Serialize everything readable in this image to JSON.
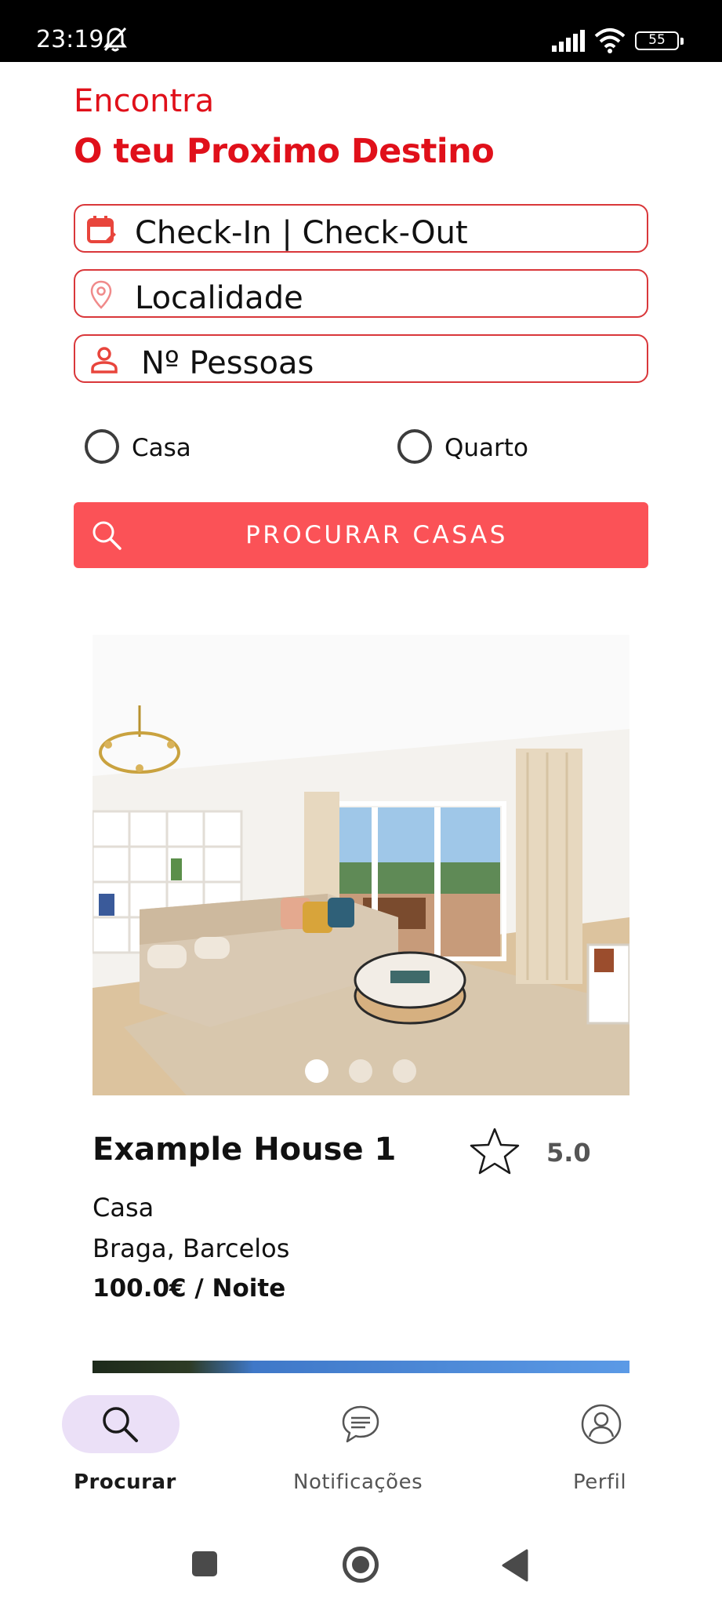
{
  "status_bar": {
    "time": "23:19",
    "battery": "55",
    "icons": [
      "bell-off-icon",
      "signal-icon",
      "wifi-icon",
      "battery-icon"
    ]
  },
  "header": {
    "eyebrow": "Encontra",
    "title": "O teu Proximo Destino"
  },
  "search_form": {
    "dates_field": {
      "icon": "calendar-icon",
      "text": "Check-In | Check-Out"
    },
    "location_field": {
      "icon": "location-pin-icon",
      "text": "Localidade"
    },
    "guests_field": {
      "icon": "person-icon",
      "text": "Nº Pessoas"
    },
    "property_types": [
      {
        "label": "Casa",
        "selected": false
      },
      {
        "label": "Quarto",
        "selected": false
      }
    ],
    "submit_label": "PROCURAR CASAS",
    "submit_icon": "search-icon"
  },
  "listings": [
    {
      "title": "Example House 1",
      "rating": "5.0",
      "type": "Casa",
      "location": "Braga, Barcelos",
      "price": "100.0€ / Noite",
      "image_count": 3,
      "active_image": 0
    }
  ],
  "bottom_nav": [
    {
      "label": "Procurar",
      "icon": "search-icon",
      "active": true
    },
    {
      "label": "Notificações",
      "icon": "chat-bubble-icon",
      "active": false
    },
    {
      "label": "Perfil",
      "icon": "profile-icon",
      "active": false
    }
  ],
  "colors": {
    "brand_red": "#e0101a",
    "field_border": "#d9373a",
    "button_bg": "#fb5257",
    "nav_active_pill": "#ebe0f7"
  }
}
